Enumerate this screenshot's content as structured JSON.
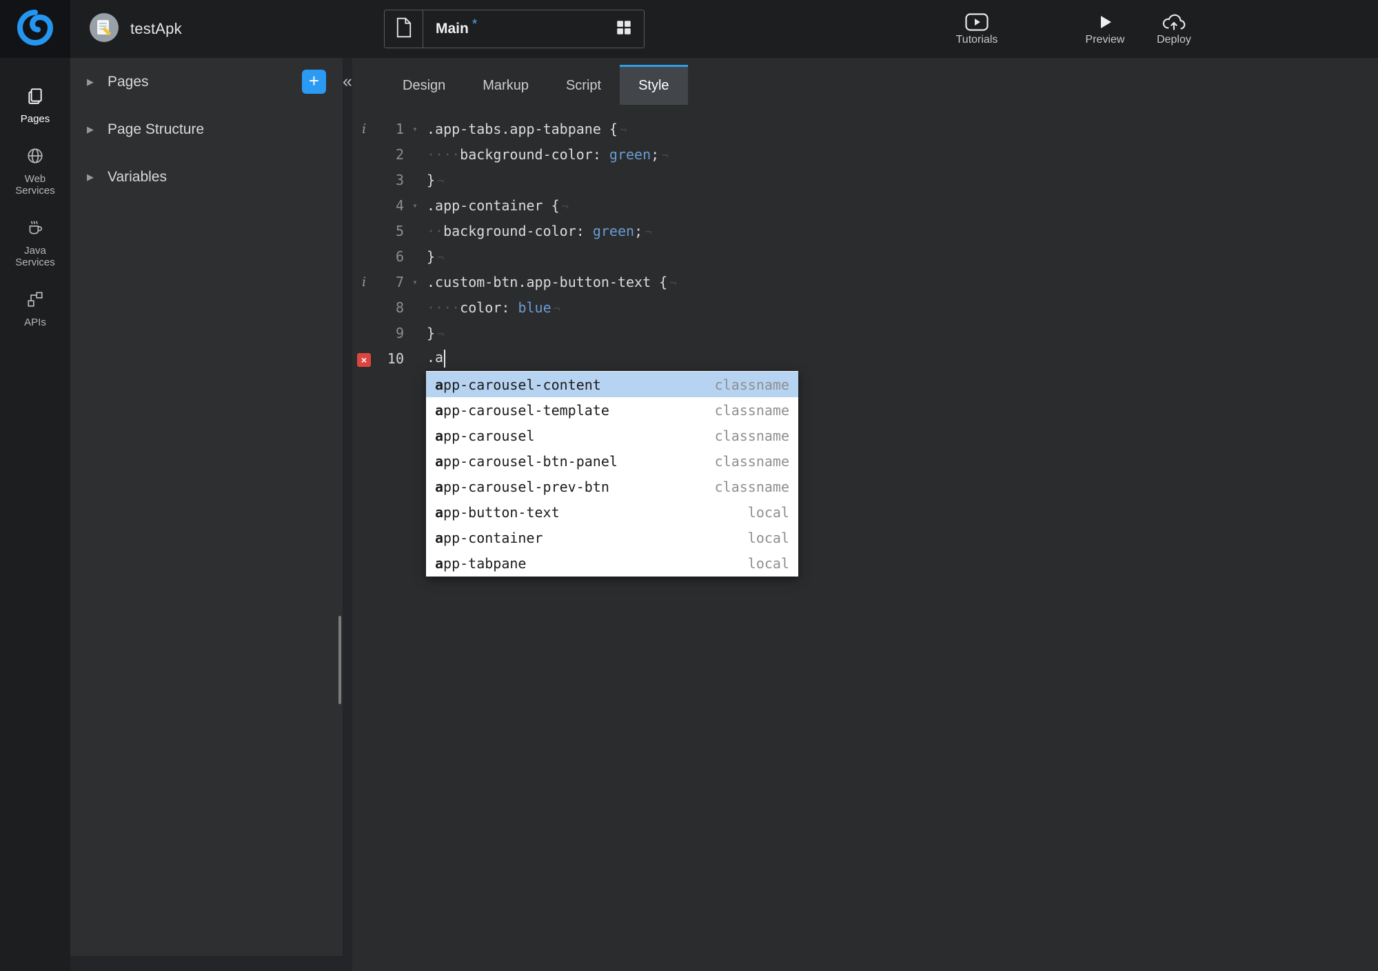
{
  "colors": {
    "accent_blue": "#2b9af3",
    "tab_indicator": "#2d9fe8",
    "error_red": "#de4540",
    "css_value_token": "#6b9bd2",
    "autocomplete_selection": "#b7d3f2",
    "dirty_marker_blue": "#55a7f0"
  },
  "topbar": {
    "project_name": "testApk",
    "page_selector": {
      "page_name": "Main",
      "dirty_marker": "*"
    },
    "actions": [
      {
        "label": "Tutorials",
        "icon": "youtube-icon"
      },
      {
        "label": "Preview",
        "icon": "play-icon"
      },
      {
        "label": "Deploy",
        "icon": "cloud-upload-icon"
      }
    ]
  },
  "rail": {
    "items": [
      {
        "label": "Pages",
        "icon": "pages-icon",
        "active": true
      },
      {
        "label": "Web Services",
        "icon": "globe-icon"
      },
      {
        "label": "Java Services",
        "icon": "coffee-icon"
      },
      {
        "label": "APIs",
        "icon": "api-icon"
      }
    ]
  },
  "sidebar": {
    "collapse_glyph": "«",
    "add_button_glyph": "+",
    "sections": [
      {
        "label": "Pages",
        "has_add_button": true
      },
      {
        "label": "Page Structure"
      },
      {
        "label": "Variables"
      }
    ]
  },
  "main": {
    "tabs": [
      {
        "label": "Design"
      },
      {
        "label": "Markup"
      },
      {
        "label": "Script"
      },
      {
        "label": "Style",
        "active": true
      }
    ]
  },
  "editor": {
    "language": "css",
    "lines": [
      {
        "num": "1",
        "icon": "info",
        "fold": true,
        "eol": true,
        "segments": [
          {
            "type": "code",
            "text": ".app-tabs.app-tabpane {"
          }
        ]
      },
      {
        "num": "2",
        "eol": true,
        "segments": [
          {
            "type": "ws",
            "text": "····"
          },
          {
            "type": "code",
            "text": "background-color: "
          },
          {
            "type": "value",
            "text": "green"
          },
          {
            "type": "code",
            "text": ";"
          }
        ]
      },
      {
        "num": "3",
        "eol": true,
        "segments": [
          {
            "type": "code",
            "text": "}"
          }
        ]
      },
      {
        "num": "4",
        "fold": true,
        "eol": true,
        "segments": [
          {
            "type": "code",
            "text": ".app-container {"
          }
        ]
      },
      {
        "num": "5",
        "eol": true,
        "segments": [
          {
            "type": "ws",
            "text": "··"
          },
          {
            "type": "code",
            "text": "background-color: "
          },
          {
            "type": "value",
            "text": "green"
          },
          {
            "type": "code",
            "text": ";"
          }
        ]
      },
      {
        "num": "6",
        "eol": true,
        "segments": [
          {
            "type": "code",
            "text": "}"
          }
        ]
      },
      {
        "num": "7",
        "icon": "info",
        "fold": true,
        "eol": true,
        "segments": [
          {
            "type": "code",
            "text": ".custom-btn.app-button-text {"
          }
        ]
      },
      {
        "num": "8",
        "eol": true,
        "segments": [
          {
            "type": "ws",
            "text": "····"
          },
          {
            "type": "code",
            "text": "color: "
          },
          {
            "type": "value",
            "text": "blue"
          }
        ]
      },
      {
        "num": "9",
        "eol": true,
        "segments": [
          {
            "type": "code",
            "text": "}"
          }
        ]
      },
      {
        "num": "10",
        "icon": "error",
        "current": true,
        "cursor": true,
        "segments": [
          {
            "type": "code",
            "text": ".a"
          }
        ]
      }
    ]
  },
  "autocomplete": {
    "typed_prefix": "a",
    "items": [
      {
        "text": "app-carousel-content",
        "kind": "classname",
        "selected": true
      },
      {
        "text": "app-carousel-template",
        "kind": "classname"
      },
      {
        "text": "app-carousel",
        "kind": "classname"
      },
      {
        "text": "app-carousel-btn-panel",
        "kind": "classname"
      },
      {
        "text": "app-carousel-prev-btn",
        "kind": "classname"
      },
      {
        "text": "app-button-text",
        "kind": "local"
      },
      {
        "text": "app-container",
        "kind": "local"
      },
      {
        "text": "app-tabpane",
        "kind": "local"
      }
    ]
  }
}
